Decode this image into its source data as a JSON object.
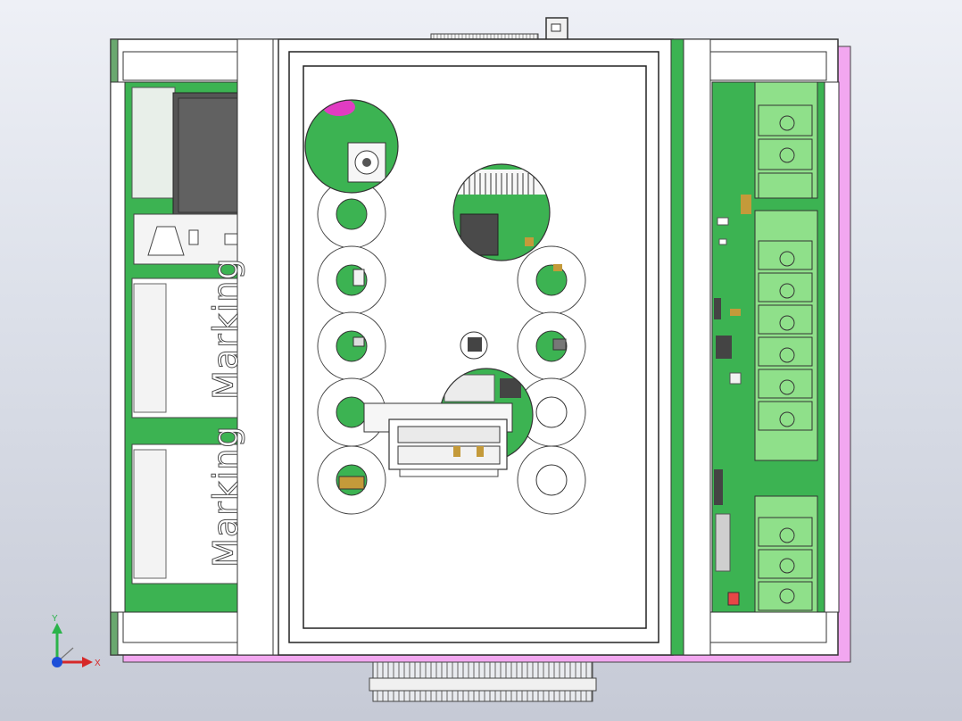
{
  "view": {
    "name": "cad-top-view-pcb-enclosure",
    "colors": {
      "background_top": "#eef0f6",
      "background_bottom": "#c6cad6",
      "pcb_green": "#3cb352",
      "connector_light_green": "#8fe08a",
      "pink_board": "#f2a7f0",
      "housing_white": "#ffffff",
      "edge_gray": "#3c3c3c"
    }
  },
  "labels": {
    "marking_top": "Marking",
    "marking_bottom": "Marking"
  },
  "triad": {
    "x_label": "X",
    "y_label": "Y"
  }
}
